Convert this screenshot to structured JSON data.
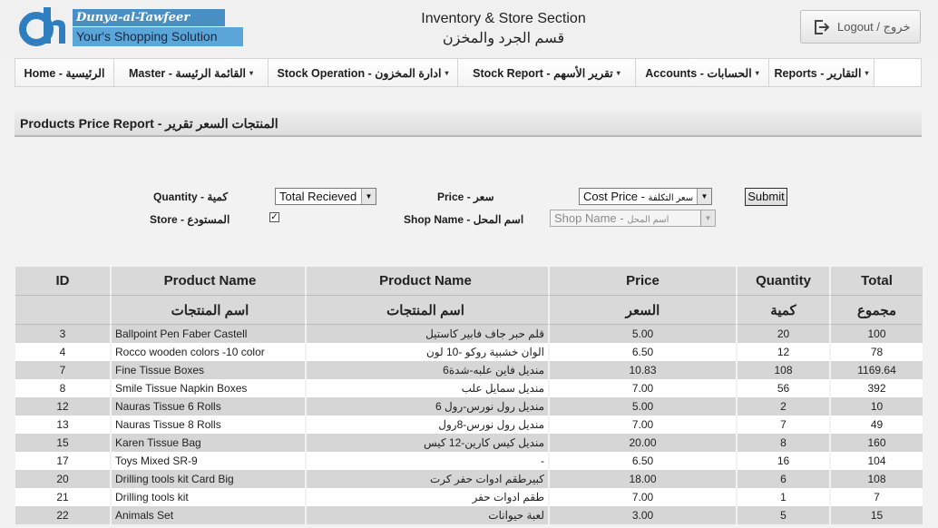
{
  "header": {
    "logo_top": "Dunya-al-Tawfeer",
    "logo_bottom": "Your's Shopping Solution",
    "section_title": "Inventory & Store Section",
    "section_subtitle": "قسم الجرد والمخزن",
    "logout_label": "Logout / خروج"
  },
  "nav": [
    {
      "label": "Home - الرئيسية",
      "has_arrow": false
    },
    {
      "label": "Master - القائمة الرئيسة",
      "has_arrow": true
    },
    {
      "label": "Stock Operation - ادارة المخزون",
      "has_arrow": true
    },
    {
      "label": "Stock Report - تقرير الأسهم",
      "has_arrow": true
    },
    {
      "label": "Accounts - الحسابات",
      "has_arrow": true
    },
    {
      "label": "Reports - التقارير",
      "has_arrow": true
    }
  ],
  "page_title": "Products Price Report - المنتجات السعر تقرير",
  "form": {
    "quantity_label": "Quantity - كمية",
    "quantity_value": "Total Recieved",
    "price_label": "Price - سعر",
    "price_value_en": "Cost Price - ",
    "price_value_ar": "سعر التكلفة",
    "submit_label": "Submit",
    "store_label": "Store - المستودع",
    "store_checked": "✓",
    "shop_label": "Shop Name - اسم المحل",
    "shop_value_en": "Shop Name - ",
    "shop_value_ar": "اسم المحل"
  },
  "table": {
    "headers_en": [
      "ID",
      "Product Name",
      "Product Name",
      "Price",
      "Quantity",
      "Total"
    ],
    "headers_ar": [
      "",
      "اسم المنتجات",
      "اسم المنتجات",
      "السعر",
      "كمية",
      "مجموع"
    ],
    "rows": [
      [
        "3",
        "Ballpoint Pen Faber Castell",
        "قلم حبر جاف فابير كاستيل",
        "5.00",
        "20",
        "100"
      ],
      [
        "4",
        "Rocco wooden colors -10 color",
        "الوان خشبية روكو -10 لون",
        "6.50",
        "12",
        "78"
      ],
      [
        "7",
        "Fine Tissue Boxes",
        "منديل فاين علبه-شدة6",
        "10.83",
        "108",
        "1169.64"
      ],
      [
        "8",
        "Smile Tissue Napkin Boxes",
        "منديل سمايل علب",
        "7.00",
        "56",
        "392"
      ],
      [
        "12",
        "Nauras Tissue 6 Rolls",
        "منديل رول نورس-رول 6",
        "5.00",
        "2",
        "10"
      ],
      [
        "13",
        "Nauras Tissue 8 Rolls",
        "منديل رول نورس-8رول",
        "7.00",
        "7",
        "49"
      ],
      [
        "15",
        "Karen Tissue Bag",
        "منديل كيس كارين-12 كيس",
        "20.00",
        "8",
        "160"
      ],
      [
        "17",
        "Toys Mixed SR-9",
        "-",
        "6.50",
        "16",
        "104"
      ],
      [
        "20",
        "Drilling tools kit Card Big",
        "كبيرطقم ادوات حفر كرت",
        "18.00",
        "6",
        "108"
      ],
      [
        "21",
        "Drilling tools kit",
        "طقم ادوات حفر",
        "7.00",
        "1",
        "7"
      ],
      [
        "22",
        "Animals Set",
        "لعبة حيوانات",
        "3.00",
        "5",
        "15"
      ]
    ]
  }
}
